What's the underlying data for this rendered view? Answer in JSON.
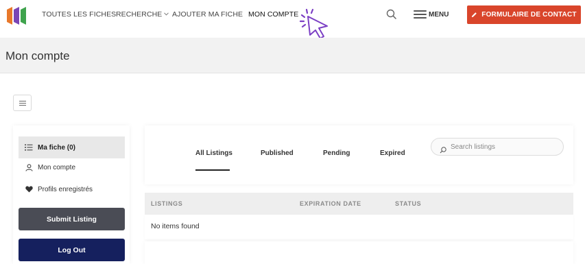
{
  "nav": {
    "links": [
      "TOUTES LES FICHES",
      "RECHERCHE",
      "AJOUTER MA FICHE",
      "MON COMPTE"
    ],
    "menu_label": "MENU",
    "contact_label": "FORMULAIRE DE CONTACT"
  },
  "page": {
    "title": "Mon compte"
  },
  "sidebar": {
    "items": [
      {
        "label": "Ma fiche (0)",
        "icon": "list-icon"
      },
      {
        "label": "Mon compte",
        "icon": "user-icon"
      },
      {
        "label": "Profils enregistrés",
        "icon": "heart-icon"
      }
    ],
    "submit_label": "Submit Listing",
    "logout_label": "Log Out"
  },
  "listings": {
    "tabs": [
      "All Listings",
      "Published",
      "Pending",
      "Expired"
    ],
    "search_placeholder": "Search listings",
    "columns": [
      "LISTINGS",
      "EXPIRATION DATE",
      "STATUS"
    ],
    "empty_message": "No items found"
  },
  "colors": {
    "contact_button": "#d9452b",
    "submit_button": "#4a4c55",
    "logout_button": "#15205e",
    "cursor": "#7b3fc4"
  }
}
